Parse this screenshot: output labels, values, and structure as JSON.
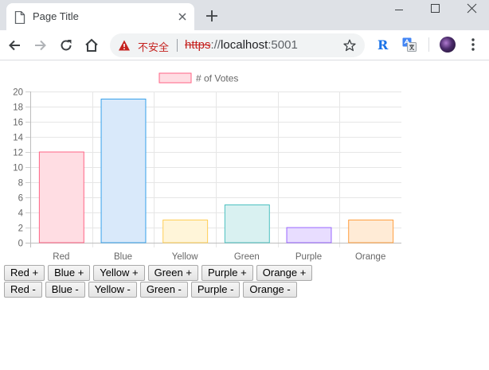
{
  "browser": {
    "tab_title": "Page Title",
    "security_label": "不安全",
    "url_scheme": "https",
    "url_separator": "://",
    "url_host": "localhost",
    "url_port": ":5001",
    "ext_rx_label": "R",
    "icons": {
      "favicon": "document-icon",
      "tab_close": "close-icon",
      "new_tab": "plus-icon",
      "back": "back-arrow-icon",
      "forward": "forward-arrow-icon",
      "reload": "reload-icon",
      "home": "home-icon",
      "warning": "warning-icon",
      "bookmark": "star-icon",
      "translate": "translate-icon",
      "menu": "more-vert-icon"
    }
  },
  "chart_data": {
    "type": "bar",
    "categories": [
      "Red",
      "Blue",
      "Yellow",
      "Green",
      "Purple",
      "Orange"
    ],
    "series": [
      {
        "name": "# of Votes",
        "values": [
          12,
          19,
          3,
          5,
          2,
          3
        ]
      }
    ],
    "ylim": [
      0,
      20
    ],
    "yticks": [
      "0",
      "2",
      "4",
      "6",
      "8",
      "10",
      "12",
      "14",
      "16",
      "18",
      "20"
    ],
    "grid": true,
    "legend": "top",
    "fill_colors": [
      "#ffdde3",
      "#d9e9fa",
      "#fff5d9",
      "#d9f1f1",
      "#e8ddff",
      "#ffebd6"
    ],
    "border_colors": [
      "#ff6384",
      "#36a2eb",
      "#ffce56",
      "#4bc0c0",
      "#9966ff",
      "#ff9f40"
    ]
  },
  "buttons": {
    "increment": [
      "Red +",
      "Blue +",
      "Yellow +",
      "Green +",
      "Purple +",
      "Orange +"
    ],
    "decrement": [
      "Red -",
      "Blue -",
      "Yellow -",
      "Green -",
      "Purple -",
      "Orange -"
    ]
  }
}
